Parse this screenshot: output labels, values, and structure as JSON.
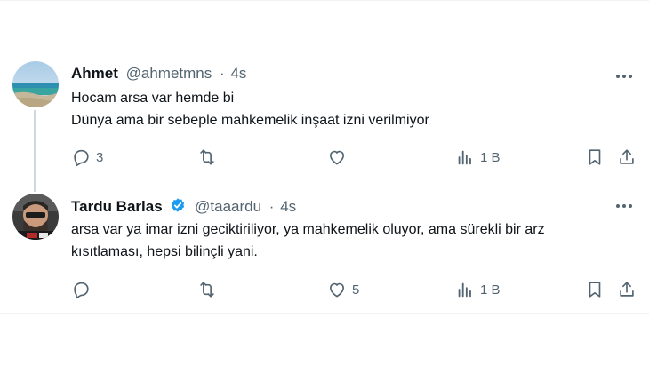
{
  "tweets": [
    {
      "name": "Ahmet",
      "handle": "@ahmetmns",
      "separator": "·",
      "time": "4s",
      "verified": false,
      "lines": [
        "Hocam arsa var hemde bi",
        "Dünya ama bir sebeple mahkemelik inşaat izni verilmiyor"
      ],
      "replies": "3",
      "retweets": "",
      "likes": "",
      "views": "1 B"
    },
    {
      "name": "Tardu Barlas",
      "handle": "@taaardu",
      "separator": "·",
      "time": "4s",
      "verified": true,
      "lines": [
        "arsa var ya imar izni geciktiriliyor, ya mahkemelik oluyor, ama sürekli bir arz",
        "kısıtlaması, hepsi bilinçli yani."
      ],
      "replies": "",
      "retweets": "",
      "likes": "5",
      "views": "1 B"
    }
  ],
  "colors": {
    "text": "#0f1419",
    "secondary": "#536471",
    "verified": "#1d9bf0",
    "thread_line": "#cfd9de"
  },
  "icons": [
    "comment-icon",
    "retweet-icon",
    "heart-icon",
    "views-icon",
    "bookmark-icon",
    "share-icon",
    "more-icon",
    "verified-badge-icon"
  ]
}
